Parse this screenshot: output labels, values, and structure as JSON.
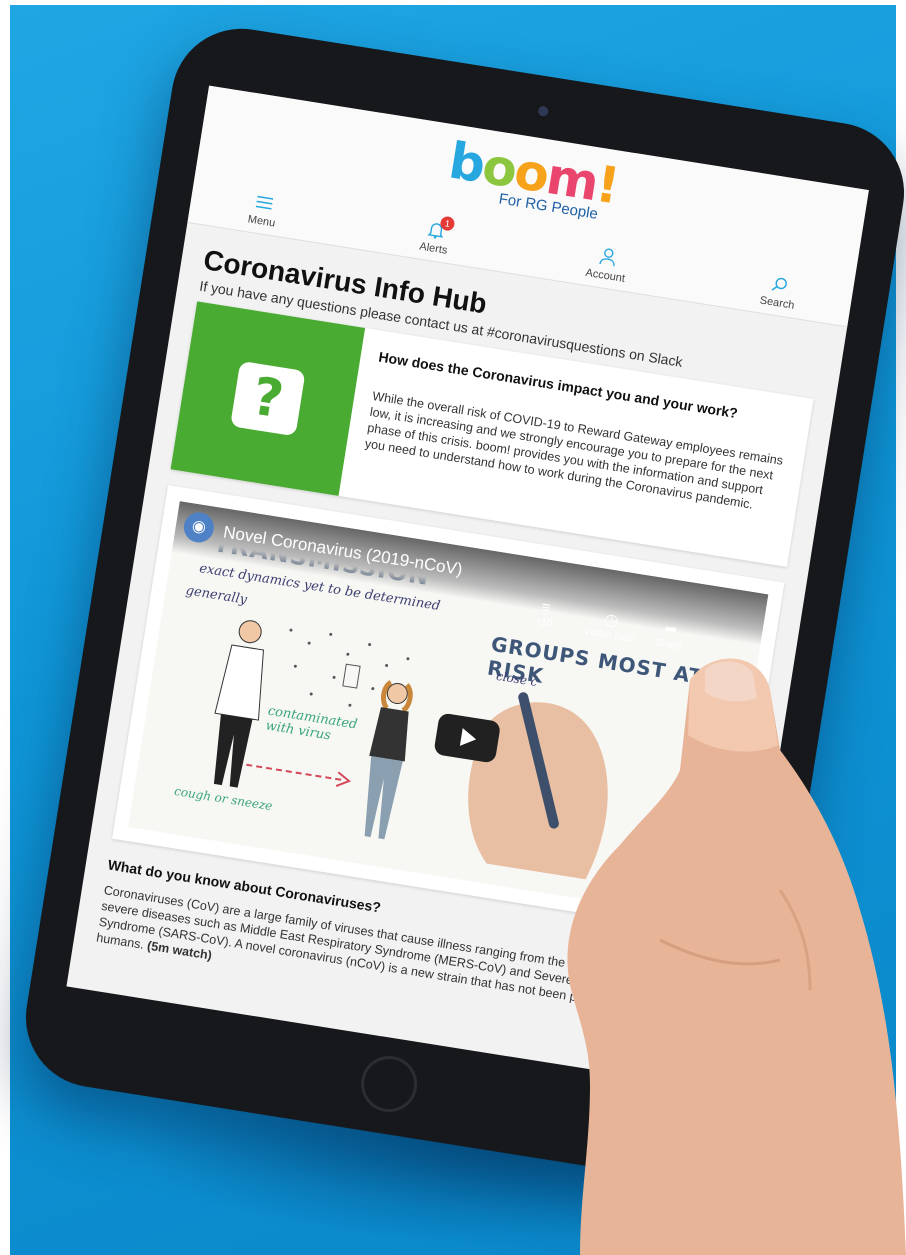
{
  "app": {
    "logo_text": "boom!",
    "logo_tagline": "For RG People"
  },
  "nav": [
    {
      "label": "Menu",
      "icon": "menu-icon"
    },
    {
      "label": "Alerts",
      "icon": "bell-icon",
      "badge": "1"
    },
    {
      "label": "Account",
      "icon": "user-icon"
    },
    {
      "label": "Search",
      "icon": "search-icon"
    }
  ],
  "page": {
    "title": "Coronavirus Info Hub",
    "subtitle": "If you have any questions please contact us at #coronavirusquestions on Slack"
  },
  "info_card": {
    "heading": "How does the Coronavirus impact you and your work?",
    "question": "While the overall risk of COVID-19 to Reward Gateway employees remains low, it is increasing and we strongly encourage you to prepare for the next phase of this crisis. boom! provides you with the information and support you need to understand how to work during the Coronavirus pandemic.",
    "icon_glyph": "?"
  },
  "video": {
    "title": "Novel Coronavirus (2019-nCoV)",
    "controls": [
      {
        "label": "+10",
        "icon": "queue-icon"
      },
      {
        "label": "Watch later",
        "icon": "clock-icon"
      },
      {
        "label": "Share",
        "icon": "share-icon"
      }
    ],
    "whiteboard": {
      "heading_left": "TRANSMISSION",
      "heading_right": "GROUPS MOST AT RISK",
      "note_1": "exact dynamics yet to be determined",
      "note_2": "generally",
      "note_3": "close c",
      "note_4": "contaminated with virus",
      "note_5": "cough or sneeze"
    }
  },
  "section": {
    "title": "What do you know about Coronaviruses?",
    "text": "Coronaviruses (CoV) are a large family of viruses that cause illness ranging from the common cold to more severe diseases such as Middle East Respiratory Syndrome (MERS-CoV) and Severe Acute Respiratory Syndrome (SARS-CoV). A novel coronavirus (nCoV) is a new strain that has not been previously identified in humans.",
    "emphasis": "(5m watch)"
  },
  "colors": {
    "background": "#0f97d8",
    "green": "#4aab32",
    "logo_blue": "#27a7df",
    "logo_pink": "#e9456d",
    "logo_orange": "#f7a21b"
  }
}
